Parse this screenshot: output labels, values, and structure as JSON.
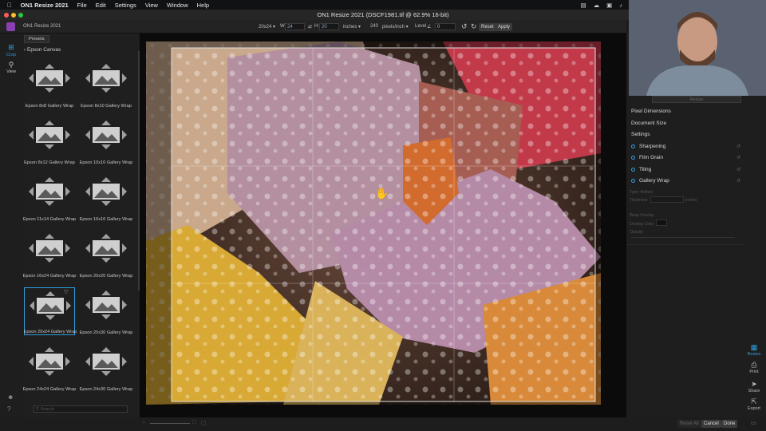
{
  "menubar": {
    "app": "ON1 Resize 2021",
    "items": [
      "File",
      "Edit",
      "Settings",
      "View",
      "Window",
      "Help"
    ]
  },
  "window": {
    "title": "ON1 Resize 2021 (DSCF1981.tif @ 62.9% 16-bit)",
    "app_label": "ON1 Resize 2021"
  },
  "toolbar": {
    "size_preset": "20x24",
    "w_label": "W:",
    "w_value": "24",
    "h_label": "H:",
    "h_value": "20",
    "units": "inches",
    "resolution": "240",
    "res_units": "pixels/inch",
    "level_label": "Level",
    "level_value": "0",
    "reset": "Reset",
    "apply": "Apply"
  },
  "leftrail": {
    "crop": "Crop",
    "view": "View"
  },
  "presets": {
    "tab": "Presets",
    "back_label": "Epson Canvas",
    "items": [
      "Epson 8x8 Gallery Wrap",
      "Epson 8x10 Gallery Wrap",
      "Epson 8x12 Gallery Wrap",
      "Epson 10x10 Gallery Wrap",
      "Epson 11x14 Gallery Wrap",
      "Epson 16x16 Gallery Wrap",
      "Epson 16x24 Gallery Wrap",
      "Epson 20x20 Gallery Wrap",
      "Epson 20x24 Gallery Wrap",
      "Epson 20x30 Gallery Wrap",
      "Epson 24x24 Gallery Wrap",
      "Epson 24x30 Gallery Wrap"
    ],
    "selected": "Epson 20x24 Gallery Wrap",
    "search_placeholder": "Search"
  },
  "rightpanel": {
    "resize_button": "Resize",
    "sections": [
      "Pixel Dimensions",
      "Document Size",
      "Settings"
    ],
    "toggles": [
      "Sharpening",
      "Film Grain",
      "Tiling",
      "Gallery Wrap"
    ],
    "faint": {
      "type": "Type: Reflect",
      "thickness": "Thickness",
      "thickness_unit": "inches",
      "wrap_overlay": "Wrap Overlay",
      "overlay_color": "Overlay Color",
      "opacity": "Opacity"
    }
  },
  "bottom": {
    "reset_all": "Reset All",
    "cancel": "Cancel",
    "done": "Done"
  },
  "rightrail": {
    "resize": "Resize",
    "print": "Print",
    "share": "Share",
    "export": "Export"
  },
  "colors": {
    "accent": "#2f9fe0",
    "bg": "#1b1b1b"
  }
}
